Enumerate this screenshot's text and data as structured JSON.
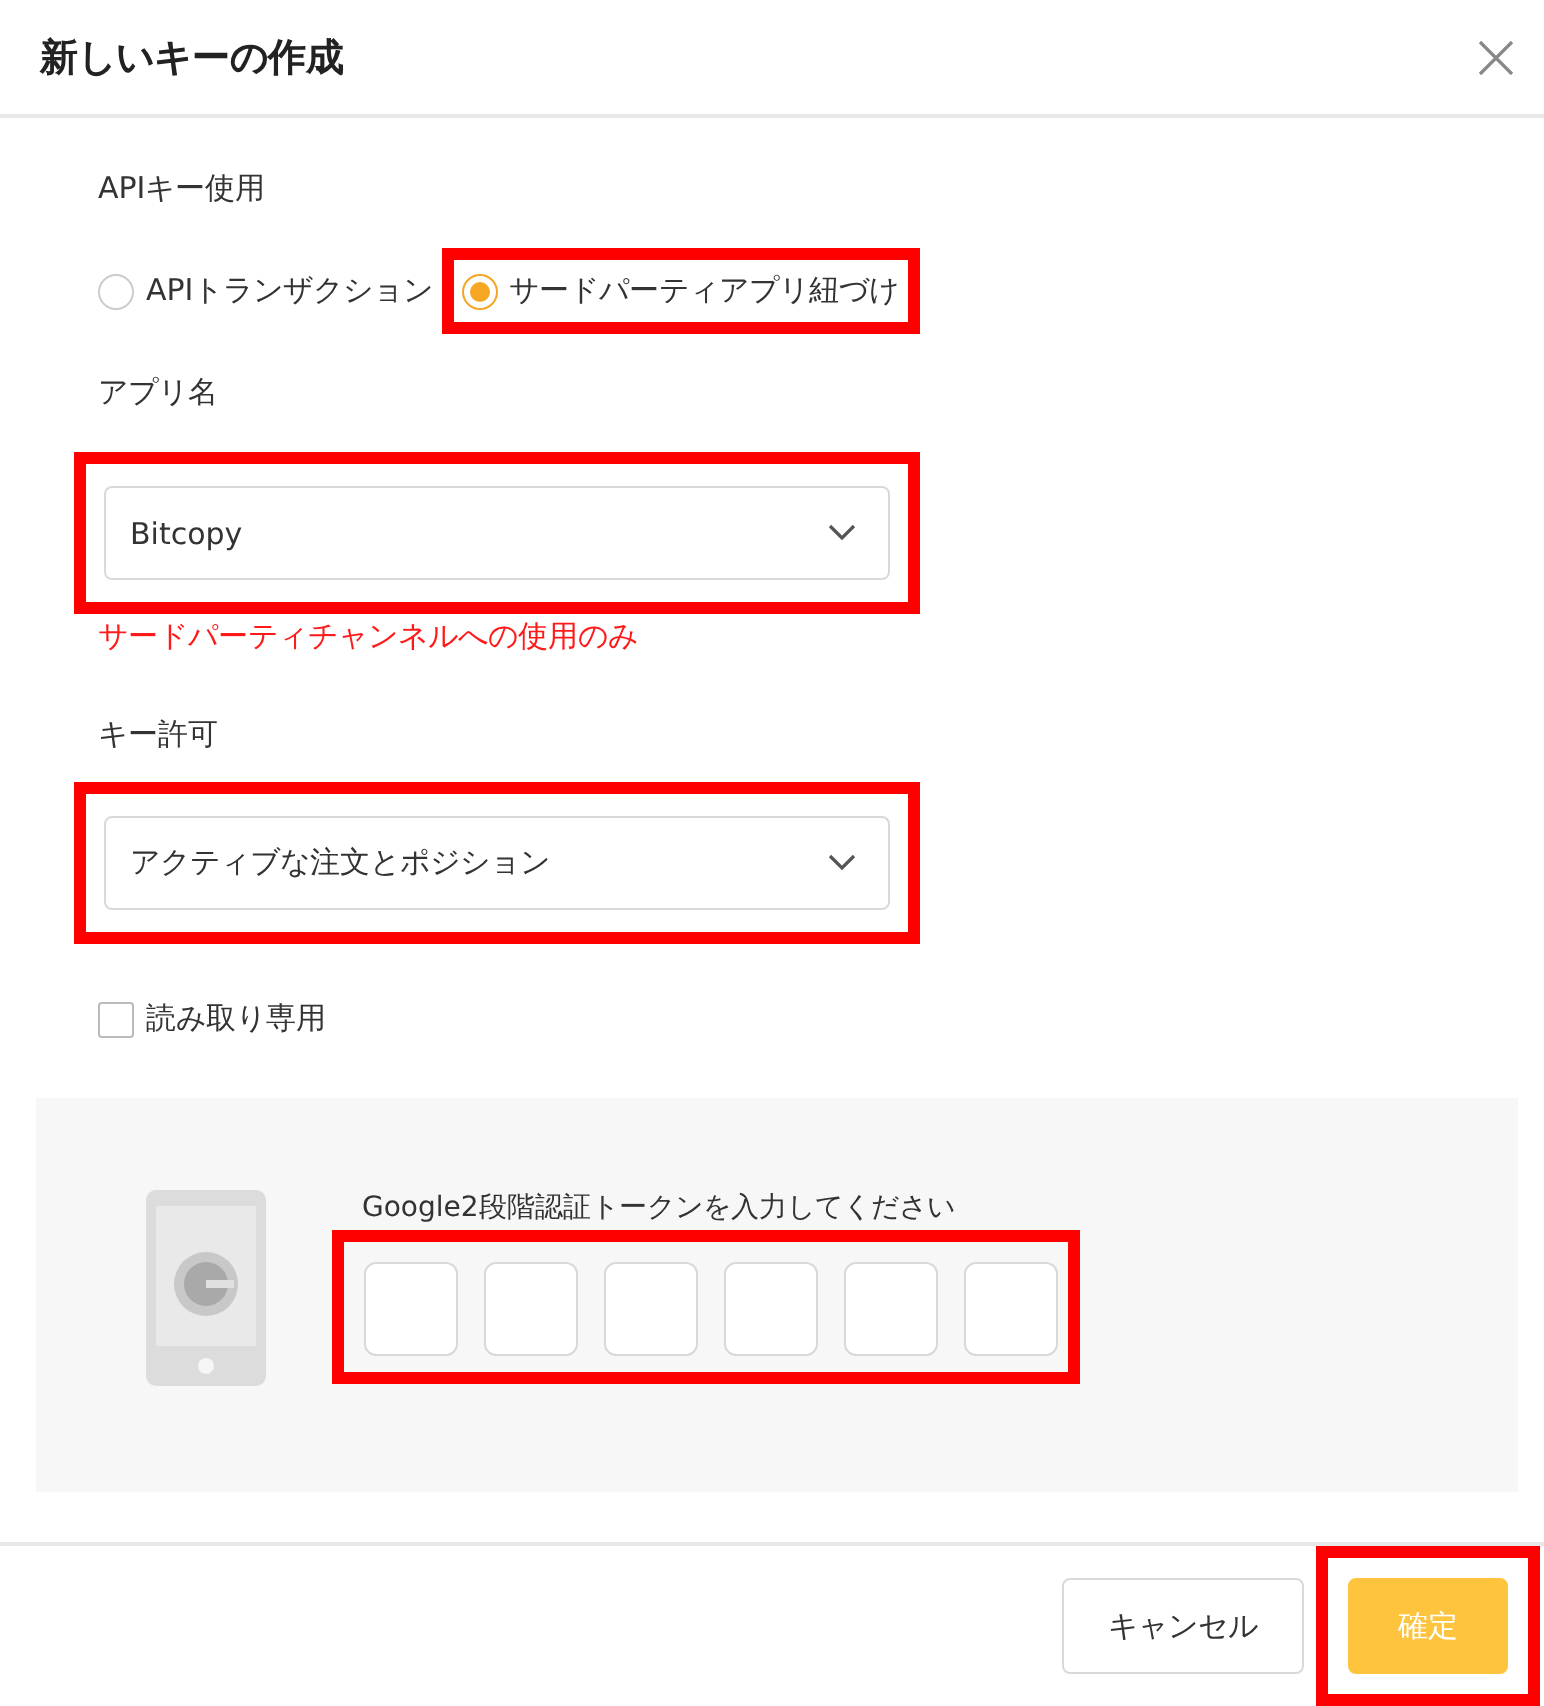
{
  "dialog": {
    "title": "新しいキーの作成"
  },
  "usage": {
    "label": "APIキー使用",
    "options": [
      {
        "label": "APIトランザクション",
        "selected": false,
        "highlighted": false
      },
      {
        "label": "サードパーティアプリ紐づけ",
        "selected": true,
        "highlighted": true
      }
    ]
  },
  "app": {
    "label": "アプリ名",
    "value": "Bitcopy",
    "highlighted": true,
    "note": "サードパーティチャンネルへの使用のみ"
  },
  "permission": {
    "label": "キー許可",
    "value": "アクティブな注文とポジション",
    "highlighted": true
  },
  "read_only": {
    "label": "読み取り専用",
    "checked": false
  },
  "token": {
    "prompt": "Google2段階認証トークンを入力してください",
    "highlighted": true,
    "fields": [
      {
        "kind": "digit"
      },
      {
        "kind": "digit"
      },
      {
        "kind": "digit"
      },
      {
        "kind": "digit"
      },
      {
        "kind": "digit"
      },
      {
        "kind": "digit"
      }
    ]
  },
  "buttons": [
    {
      "label": "キャンセル",
      "kind": "secondary",
      "highlighted": false
    },
    {
      "label": "確定",
      "kind": "primary",
      "highlighted": true
    }
  ]
}
